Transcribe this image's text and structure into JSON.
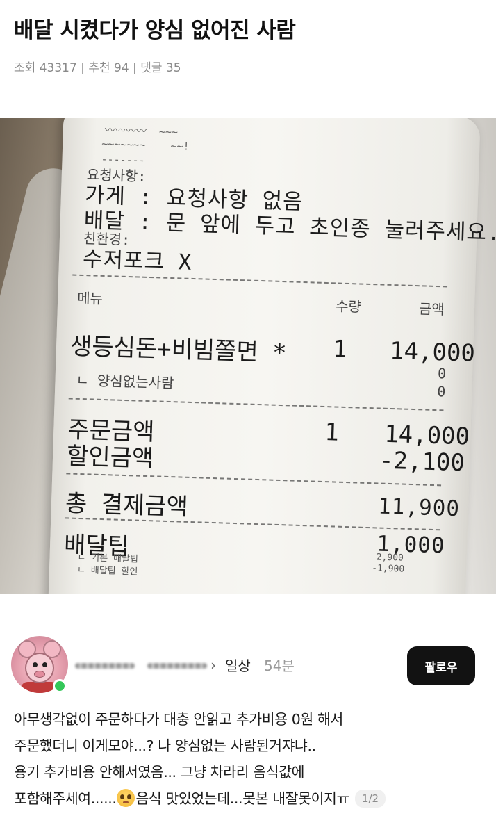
{
  "post": {
    "title": "배달 시켰다가 양심 없어진 사람",
    "views_label": "조회",
    "views": "43317",
    "recommend_label": "추천",
    "recommend": "94",
    "comments_label": "댓글",
    "comments": "35",
    "separator": " | "
  },
  "receipt": {
    "request_header": "요청사항:",
    "store_line": "가게 : 요청사항 없음",
    "delivery_line": "배달 : 문 앞에 두고 초인종 눌러주세요.",
    "eco_header": "친환경:",
    "eco_value": "수저포크 X",
    "col_menu": "메뉴",
    "col_qty": "수량",
    "col_amount": "금액",
    "item_name": "생등심돈+비빔쫄면 *",
    "item_qty": "1",
    "item_amount": "14,000",
    "option_name": "ㄴ 양심없는사람",
    "option_amount_1": "0",
    "option_amount_2": "0",
    "order_amount_label": "주문금액",
    "order_qty": "1",
    "order_amount": "14,000",
    "discount_label": "할인금액",
    "discount_amount": "-2,100",
    "total_label": "총 결제금액",
    "total_amount": "11,900",
    "tip_label": "배달팁",
    "tip_amount": "1,000",
    "tip_base_label": "ㄴ 기본 배달팁",
    "tip_base_amount": "2,900",
    "tip_discount_label": "ㄴ 배달팁 할인",
    "tip_discount_amount": "-1,900"
  },
  "author": {
    "category": "일상",
    "time": "54분",
    "follow_label": "팔로우"
  },
  "body": {
    "line1": "아무생각없이 주문하다가 대충 안읽고 추가비용 0원 해서",
    "line2": "주문했더니 이게모야...? 나 양심없는 사람된거쟈냐..",
    "line3": "용기 추가비용 안해서였음... 그냥 차라리 음식값에",
    "line4_a": "포함해주세여......",
    "line4_b": "음식 맛있었는데...못본 내잘못이지ㅠ",
    "pager": "1/2"
  }
}
